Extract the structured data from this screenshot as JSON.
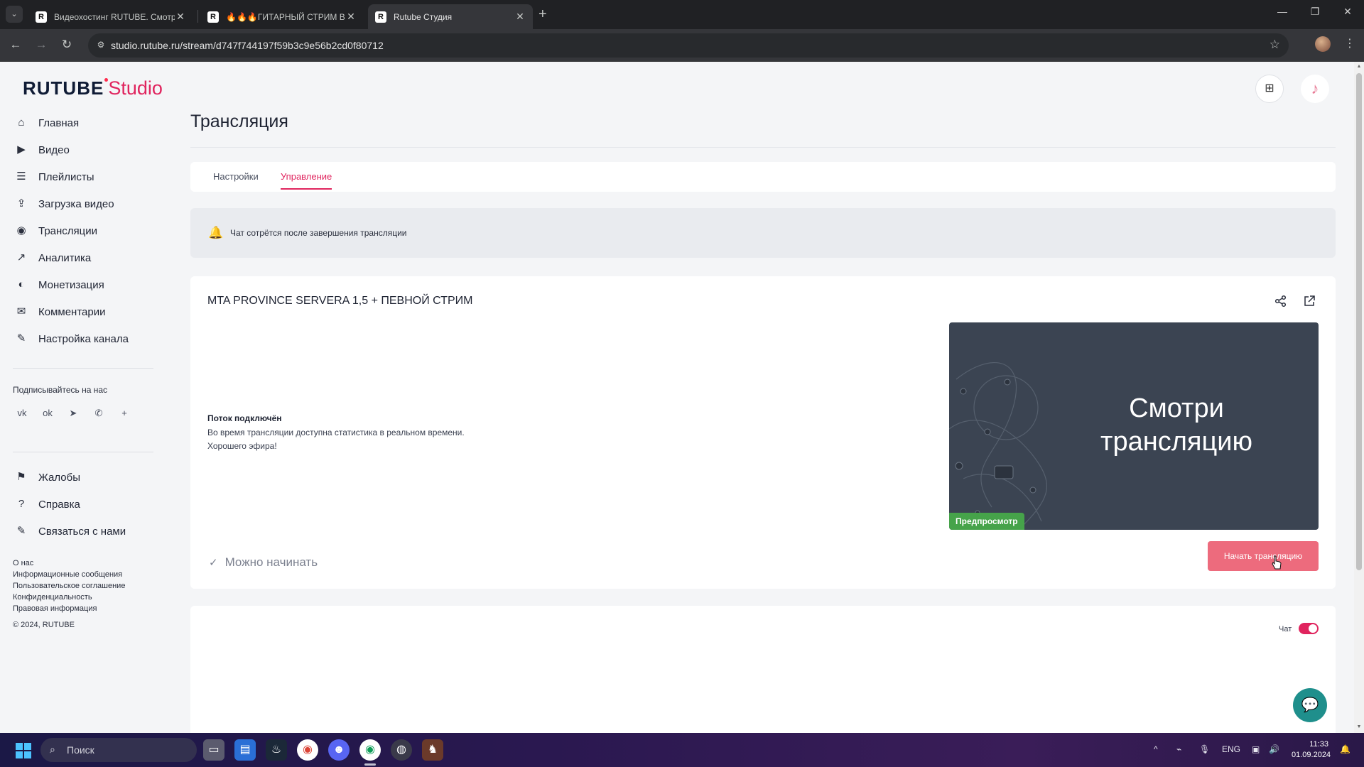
{
  "browser": {
    "tabs": [
      {
        "title": "Видеохостинг RUTUBE. Смотрите",
        "favicon": "R",
        "active": false
      },
      {
        "title": "🔥🔥🔥ГИТАРНЫЙ СТРИМ В",
        "favicon": "R",
        "active": false
      },
      {
        "title": "Rutube Студия",
        "favicon": "R",
        "active": true
      }
    ],
    "url": "studio.rutube.ru/stream/d747f744197f59b3c9e56b2cd0f80712"
  },
  "logo": {
    "brand": "RUTUBE",
    "product": "Studio"
  },
  "sidebar": {
    "items": [
      {
        "label": "Главная",
        "icon": "home-icon",
        "glyph": "⌂"
      },
      {
        "label": "Видео",
        "icon": "video-icon",
        "glyph": "▶"
      },
      {
        "label": "Плейлисты",
        "icon": "playlist-icon",
        "glyph": "☰"
      },
      {
        "label": "Загрузка видео",
        "icon": "upload-icon",
        "glyph": "⇪"
      },
      {
        "label": "Трансляции",
        "icon": "broadcast-icon",
        "glyph": "◉"
      },
      {
        "label": "Аналитика",
        "icon": "analytics-icon",
        "glyph": "↗"
      },
      {
        "label": "Монетизация",
        "icon": "monetization-icon",
        "glyph": "◐"
      },
      {
        "label": "Комментарии",
        "icon": "comments-icon",
        "glyph": "✉"
      },
      {
        "label": "Настройка канала",
        "icon": "channel-settings-icon",
        "glyph": "✎"
      }
    ],
    "subscribe_label": "Подписывайтесь на нас",
    "socials": [
      {
        "name": "vk-icon",
        "glyph": "vk"
      },
      {
        "name": "ok-icon",
        "glyph": "ok"
      },
      {
        "name": "telegram-icon",
        "glyph": "➤"
      },
      {
        "name": "viber-icon",
        "glyph": "✆"
      },
      {
        "name": "more-icon",
        "glyph": "+"
      }
    ],
    "secondary": [
      {
        "label": "Жалобы",
        "icon": "flag-icon",
        "glyph": "⚑"
      },
      {
        "label": "Справка",
        "icon": "help-icon",
        "glyph": "?"
      },
      {
        "label": "Связаться с нами",
        "icon": "contact-icon",
        "glyph": "✎"
      }
    ],
    "footer_links": [
      "О нас",
      "Информационные сообщения",
      "Пользовательское соглашение",
      "Конфиденциальность",
      "Правовая информация"
    ],
    "copyright": "© 2024, RUTUBE"
  },
  "main": {
    "title": "Трансляция",
    "tabs": [
      {
        "label": "Настройки",
        "active": false
      },
      {
        "label": "Управление",
        "active": true
      }
    ],
    "notice": "Чат сотрётся после завершения трансляции",
    "stream": {
      "title": "MTA PROVINCE SERVERA 1,5 + ПЕВНОЙ СТРИМ",
      "status_title": "Поток подключён",
      "status_lines": [
        "Во время трансляции доступна статистика в реальном времени.",
        "Хорошего эфира!"
      ],
      "preview_text_line1": "Смотри",
      "preview_text_line2": "трансляцию",
      "preview_badge": "Предпросмотр",
      "ready_label": "Можно начинать",
      "start_button": "Начать трансляцию"
    },
    "chat": {
      "label": "Чат",
      "enabled": true
    }
  },
  "taskbar": {
    "search_placeholder": "Поиск",
    "lang": "ENG",
    "time": "11:33",
    "date": "01.09.2024"
  },
  "colors": {
    "accent": "#e0245e",
    "start_button": "#ed6b7d",
    "preview_bg": "#3b4452",
    "preview_badge": "#46a34a",
    "support_fab": "#1f8f8c"
  }
}
